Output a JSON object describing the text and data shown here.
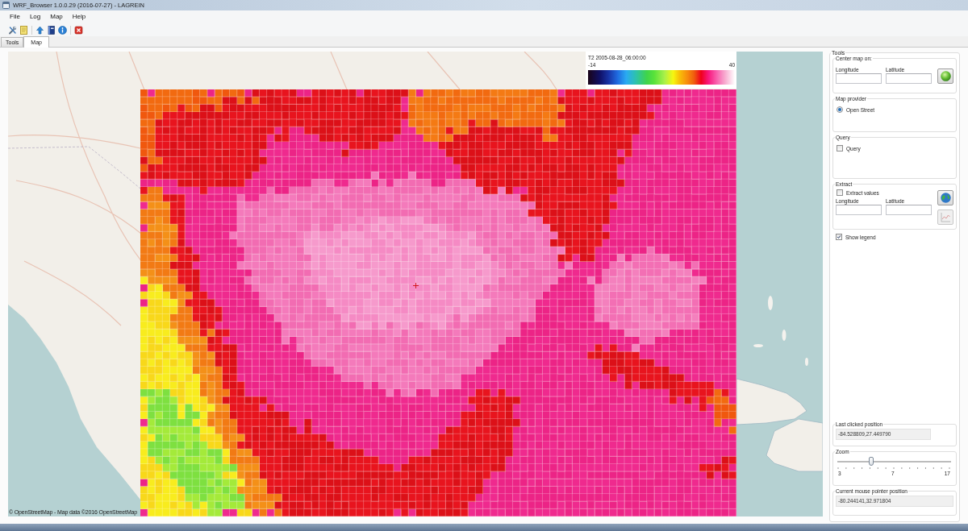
{
  "window": {
    "title": "WRF_Browser 1.0.0.29 (2016-07-27) - LAGREIN"
  },
  "menu": [
    "File",
    "Log",
    "Map",
    "Help"
  ],
  "tabs": [
    {
      "label": "Tools",
      "selected": false
    },
    {
      "label": "Map",
      "selected": true
    }
  ],
  "map": {
    "legend": {
      "title": "T2 2005-08-28_06:00:00",
      "min": "-14",
      "max": "40"
    },
    "attribution": "© OpenStreetMap - Map data ©2016 OpenStreetMap"
  },
  "tools": {
    "title": "Tools",
    "center_map": {
      "title": "Center map on:",
      "fields": [
        {
          "label": "Longitude"
        },
        {
          "label": "Latitude"
        }
      ]
    },
    "map_provider": {
      "title": "Map provider",
      "options": [
        {
          "label": "Open Street",
          "selected": true
        }
      ]
    },
    "query": {
      "title": "Query",
      "checkbox": {
        "label": "Query",
        "checked": false
      }
    },
    "extract": {
      "title": "Extract",
      "checkbox": {
        "label": "Extract values",
        "checked": false
      },
      "fields": [
        {
          "label": "Longitude"
        },
        {
          "label": "Latitude"
        }
      ],
      "buttons": [
        {
          "kind": "globe",
          "disabled": false
        },
        {
          "kind": "chart",
          "disabled": true
        }
      ]
    },
    "show_legend": {
      "label": "Show legend",
      "checked": true
    },
    "last_clicked": {
      "title": "Last clicked position",
      "value": "-84.528809,27.449790"
    },
    "zoom": {
      "title": "Zoom",
      "level": 0.29,
      "labels": [
        "3",
        "7",
        "17"
      ]
    },
    "mouse_position": {
      "title": "Current mouse pointer position",
      "value": "-80.244141,32.971804"
    }
  }
}
